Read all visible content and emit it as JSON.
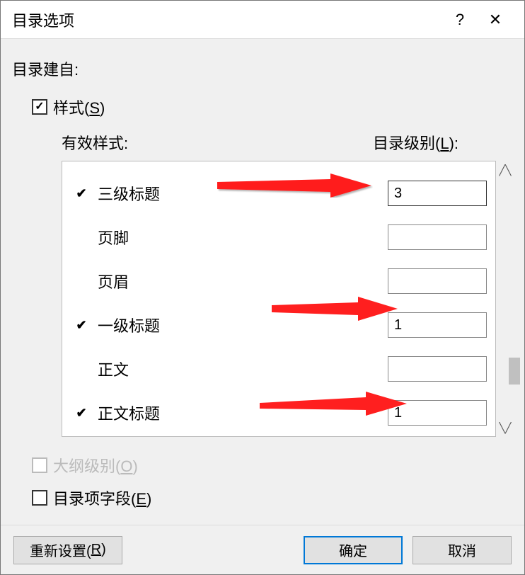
{
  "title": "目录选项",
  "help_label": "?",
  "close_label": "✕",
  "source_label": "目录建自:",
  "styles_checkbox_label": "样式(S)",
  "styles_checkbox_checked": true,
  "header_left": "有效样式:",
  "header_right": "目录级别(L):",
  "rows": [
    {
      "checked": true,
      "name": "三级标题",
      "value": "3",
      "cursor": true
    },
    {
      "checked": false,
      "name": "页脚",
      "value": ""
    },
    {
      "checked": false,
      "name": "页眉",
      "value": ""
    },
    {
      "checked": true,
      "name": "一级标题",
      "value": "1"
    },
    {
      "checked": false,
      "name": "正文",
      "value": ""
    },
    {
      "checked": true,
      "name": "正文标题",
      "value": "1"
    }
  ],
  "outline_checkbox_label": "大纲级别(O)",
  "outline_checkbox_checked": false,
  "outline_checkbox_disabled": true,
  "fields_checkbox_label": "目录项字段(E)",
  "fields_checkbox_checked": false,
  "footer": {
    "reset": "重新设置(R)",
    "ok": "确定",
    "cancel": "取消"
  }
}
